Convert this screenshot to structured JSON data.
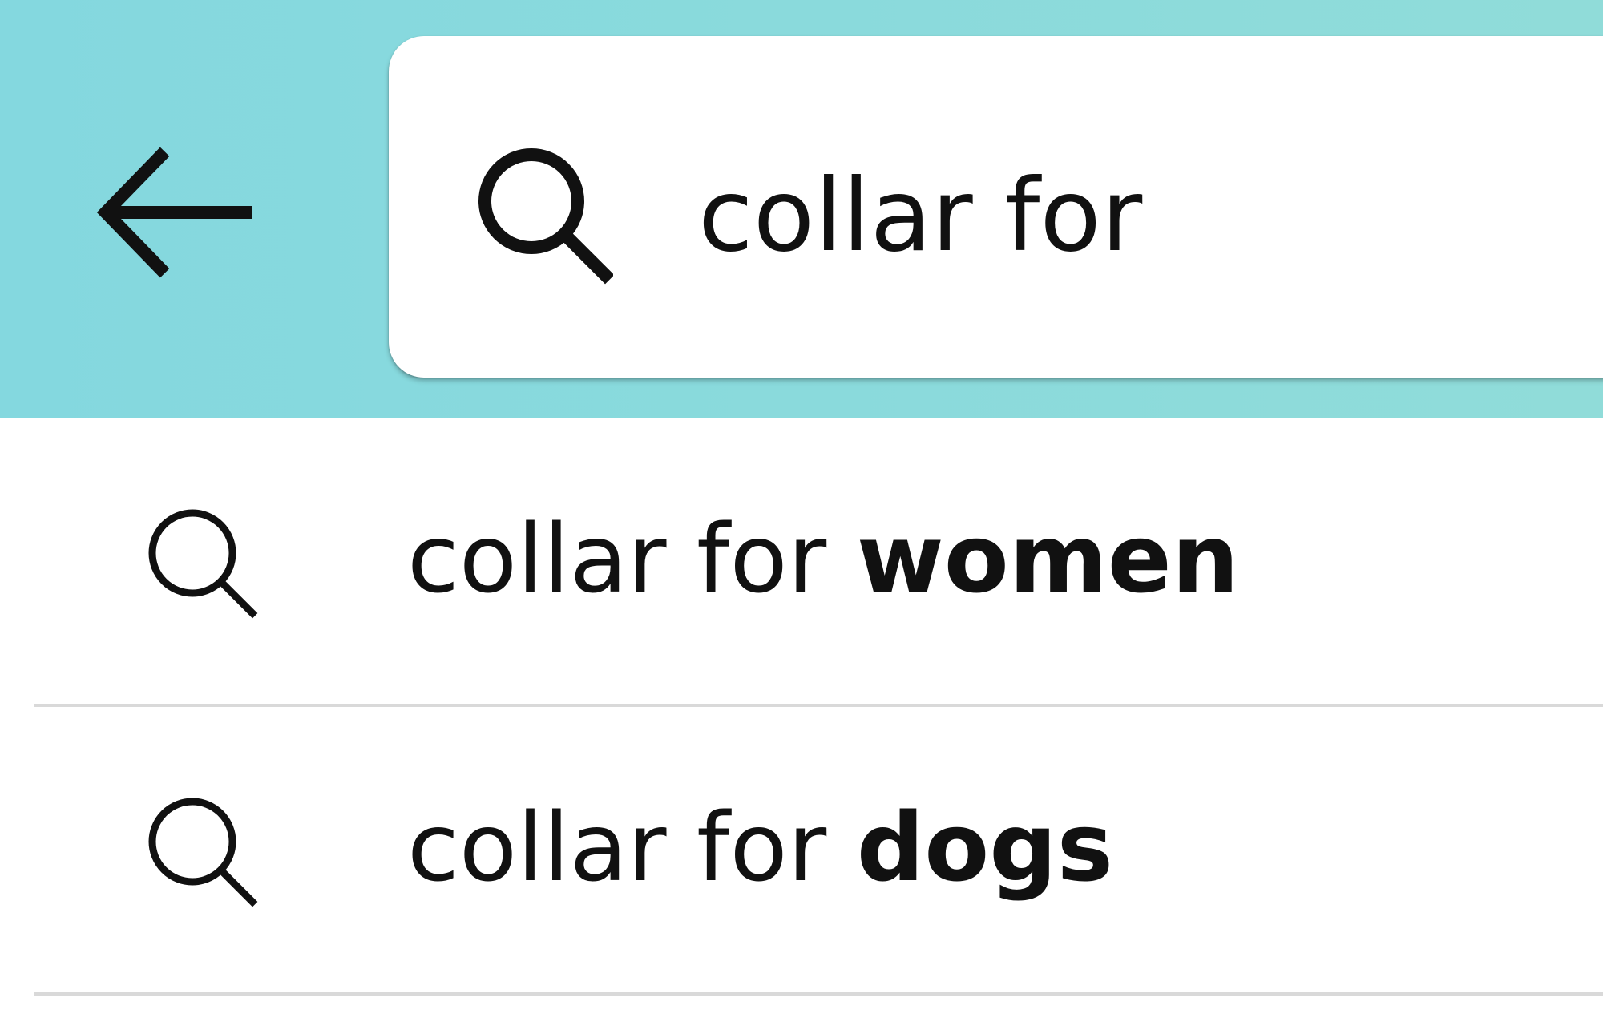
{
  "header": {
    "back_icon": "arrow-left-icon",
    "background_color": "#88d9dc"
  },
  "search": {
    "icon": "search-icon",
    "value": "collar for"
  },
  "suggestions": [
    {
      "icon": "search-icon",
      "prefix": "collar for",
      "completion": "women"
    },
    {
      "icon": "search-icon",
      "prefix": "collar for",
      "completion": "dogs"
    }
  ]
}
